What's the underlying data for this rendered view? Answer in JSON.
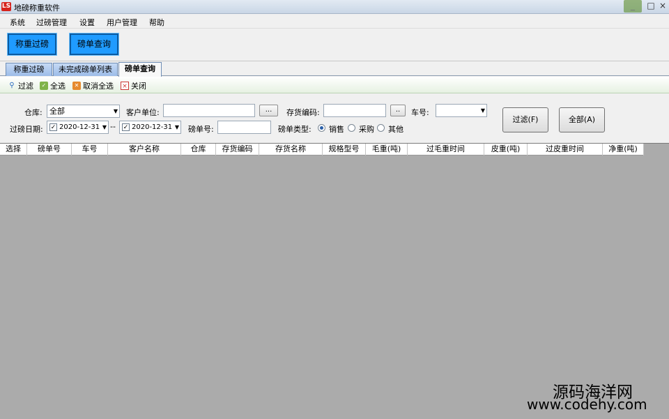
{
  "window": {
    "logo": "LS",
    "title": "地磅称重软件"
  },
  "menu": [
    "系统",
    "过磅管理",
    "设置",
    "用户管理",
    "帮助"
  ],
  "topbar": {
    "weigh": "称重过磅",
    "query": "磅单查询"
  },
  "tabs": [
    "称重过磅",
    "未完成磅单列表",
    "磅单查询"
  ],
  "subtoolbar": {
    "filter": "过滤",
    "select_all": "全选",
    "unselect_all": "取消全选",
    "close": "关闭"
  },
  "filters": {
    "warehouse_label": "仓库:",
    "warehouse_value": "全部",
    "customer_label": "客户单位:",
    "customer_value": "",
    "dots": "...",
    "stock_code_label": "存货编码:",
    "stock_code_value": "",
    "dots2": "..",
    "truck_label": "车号:",
    "truck_value": "",
    "date_label": "过磅日期:",
    "date_from": "2020-12-31",
    "date_sep": "--",
    "date_to": "2020-12-31",
    "ticket_label": "磅单号:",
    "ticket_value": "",
    "type_label": "磅单类型:",
    "types": [
      "销售",
      "采购",
      "其他"
    ],
    "selected_type": "销售",
    "filter_btn": "过滤(F)",
    "all_btn": "全部(A)"
  },
  "grid": {
    "columns": [
      "选择",
      "磅单号",
      "车号",
      "客户名称",
      "仓库",
      "存货编码",
      "存货名称",
      "规格型号",
      "毛重(吨)",
      "过毛重时间",
      "皮重(吨)",
      "过皮重时间",
      "净重(吨)"
    ],
    "rows": []
  },
  "watermark": {
    "line1": "源码海洋网",
    "line2": "www.codehy.com"
  }
}
